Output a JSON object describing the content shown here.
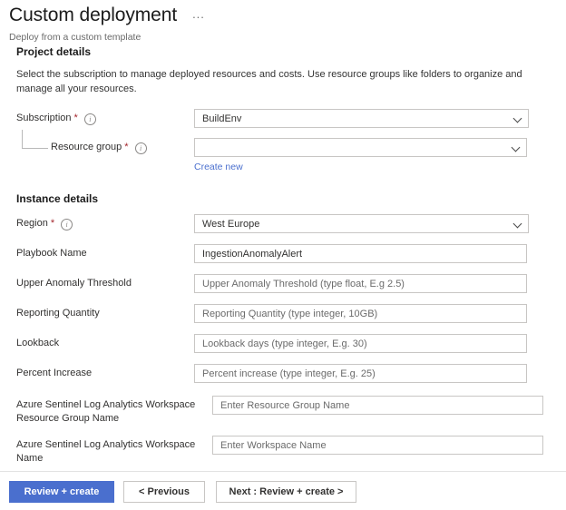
{
  "header": {
    "title": "Custom deployment",
    "more_icon": "...",
    "subtitle": "Deploy from a custom template"
  },
  "project_details": {
    "heading": "Project details",
    "description": "Select the subscription to manage deployed resources and costs. Use resource groups like folders to organize and manage all your resources.",
    "subscription": {
      "label": "Subscription",
      "required": true,
      "value": "BuildEnv"
    },
    "resource_group": {
      "label": "Resource group",
      "required": true,
      "value": "",
      "create_new_label": "Create new"
    }
  },
  "instance_details": {
    "heading": "Instance details",
    "fields": [
      {
        "label": "Region",
        "required": true,
        "info": true,
        "type": "dropdown",
        "value": "West Europe"
      },
      {
        "label": "Playbook Name",
        "required": false,
        "info": false,
        "type": "text",
        "value": "IngestionAnomalyAlert"
      },
      {
        "label": "Upper Anomaly Threshold",
        "required": false,
        "info": false,
        "type": "text",
        "value": "",
        "placeholder": "Upper Anomaly Threshold (type float, E.g 2.5)"
      },
      {
        "label": "Reporting Quantity",
        "required": false,
        "info": false,
        "type": "text",
        "value": "",
        "placeholder": "Reporting Quantity (type integer, 10GB)"
      },
      {
        "label": "Lookback",
        "required": false,
        "info": false,
        "type": "text",
        "value": "",
        "placeholder": "Lookback days (type integer, E.g. 30)"
      },
      {
        "label": "Percent Increase",
        "required": false,
        "info": false,
        "type": "text",
        "value": "",
        "placeholder": "Percent increase (type integer, E.g. 25)"
      },
      {
        "label": "Azure Sentinel Log Analytics Workspace Resource Group Name",
        "required": false,
        "info": false,
        "type": "text",
        "value": "",
        "placeholder": "Enter Resource Group Name"
      },
      {
        "label": "Azure Sentinel Log Analytics Workspace Name",
        "required": false,
        "info": false,
        "type": "text",
        "value": "",
        "placeholder": "Enter Workspace Name"
      }
    ]
  },
  "footer": {
    "review_create_label": "Review + create",
    "previous_label": "< Previous",
    "next_label": "Next : Review + create >"
  },
  "colors": {
    "primary_button": "#4a6fce",
    "link": "#4a6fce",
    "required_star": "#a4262c",
    "border": "#c8c6c4"
  }
}
